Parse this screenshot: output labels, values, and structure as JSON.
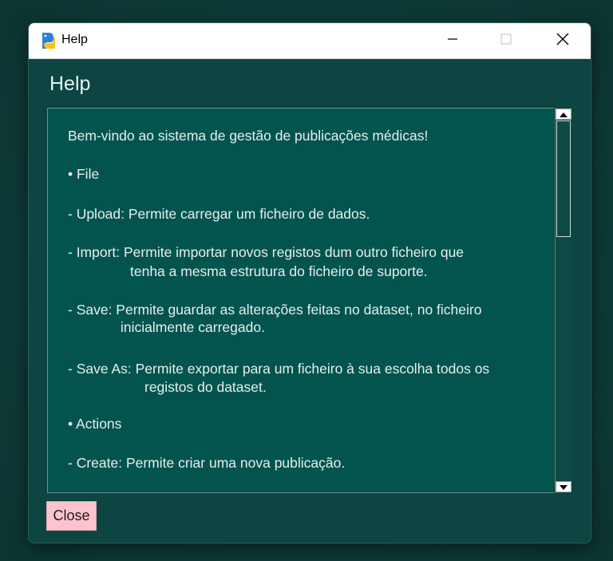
{
  "window": {
    "title": "Help",
    "controls": {
      "minimize_icon": "minimize-icon",
      "maximize_icon": "maximize-icon",
      "close_icon": "close-icon"
    },
    "app_icon": "python-logo-icon"
  },
  "dialog": {
    "heading": "Help",
    "help_lines": [
      "Bem-vindo ao sistema de gestão de publicações médicas!",
      "• File",
      "- Upload: Permite carregar um ficheiro de dados.",
      "- Import: Permite  importar novos registos dum outro ficheiro que",
      "tenha a mesma estrutura do ficheiro de suporte.",
      "- Save: Permite guardar as alterações feitas no dataset, no ficheiro",
      "inicialmente carregado.",
      "- Save As: Permite exportar para um ficheiro à sua escolha todos os",
      "registos do dataset.",
      "• Actions",
      "- Create: Permite criar uma nova publicação."
    ],
    "close_label": "Close"
  },
  "colors": {
    "background": "#0e3c38",
    "window_bg": "#0c4541",
    "textbox_bg": "#03544f",
    "close_button_bg": "#fdc4cf"
  }
}
